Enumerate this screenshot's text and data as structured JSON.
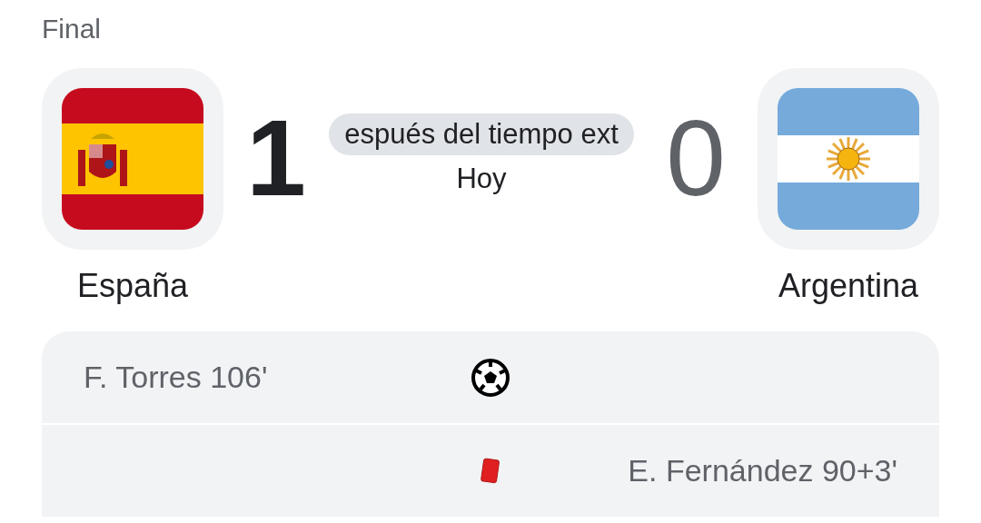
{
  "status": "Final",
  "home": {
    "name": "España",
    "score": "1",
    "winner": true,
    "flag": {
      "kind": "spain"
    }
  },
  "away": {
    "name": "Argentina",
    "score": "0",
    "winner": false,
    "flag": {
      "kind": "argentina"
    }
  },
  "match_info": {
    "note": "espués del tiempo ext",
    "date": "Hoy"
  },
  "events": [
    {
      "kind": "goal",
      "home_player": "F. Torres 106'"
    },
    {
      "kind": "red_card",
      "away_player": "E. Fernández 90+3'"
    }
  ]
}
